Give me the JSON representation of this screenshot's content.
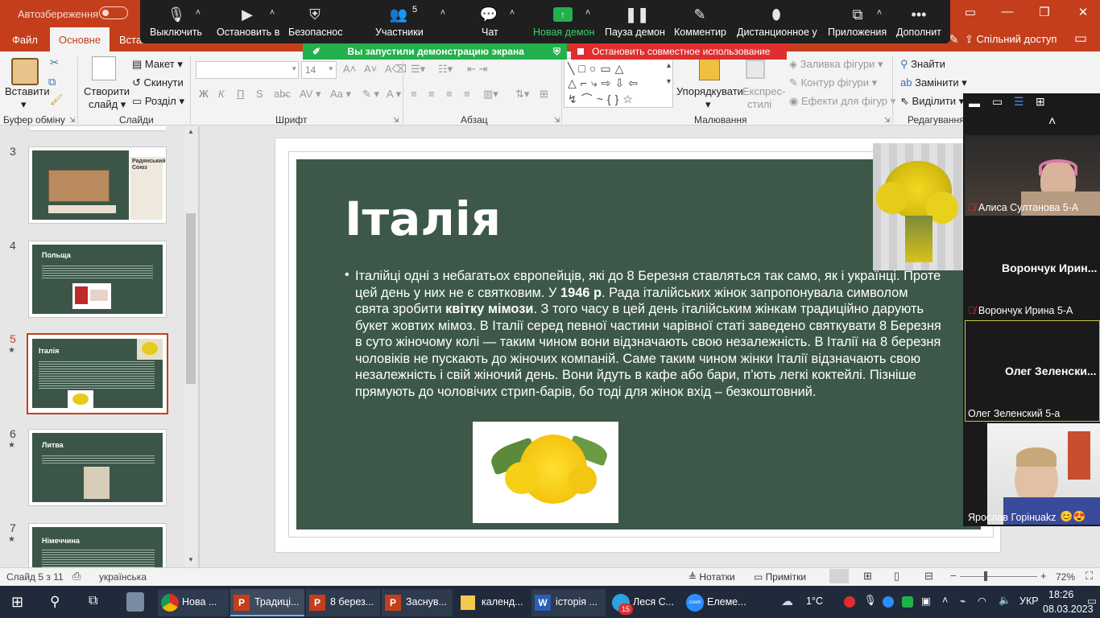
{
  "titlebar": {
    "autosave_label": "Автозбереження",
    "minimize": "—",
    "restore": "❐",
    "close": "✕"
  },
  "ribbon_tabs": {
    "file": "Файл",
    "home": "Основне",
    "insert": "Вставл",
    "share": "Спільний доступ"
  },
  "zoom_toolbar": {
    "mute": "Выключить",
    "stop_video": "Остановить в",
    "security": "Безопаснос",
    "participants": "Участники",
    "participants_count": "5",
    "chat": "Чат",
    "new_share": "Новая демон",
    "pause_share": "Пауза демон",
    "annotate": "Комментир",
    "remote_control": "Дистанционное у",
    "apps": "Приложения",
    "more": "Дополнит",
    "sharing_banner": "Вы запустили демонстрацию экрана",
    "stop_share": "Остановить совместное использование"
  },
  "ribbon": {
    "paste": "Вставити",
    "clipboard_group": "Буфер обміну",
    "new_slide": "Створити",
    "new_slide_2": "слайд",
    "layout": "Макет",
    "reset": "Скинути",
    "section": "Розділ",
    "slides_group": "Слайди",
    "font_size": "14",
    "font_group": "Шрифт",
    "bold": "Ж",
    "italic": "К",
    "underline": "П",
    "strike": "S",
    "paragraph_group": "Абзац",
    "arrange": "Упорядкувати",
    "quick_styles": "Експрес-",
    "quick_styles_2": "стилі",
    "shape_fill": "Заливка фігури",
    "shape_outline": "Контур фігури",
    "shape_effects": "Ефекти для фігур",
    "drawing_group": "Малювання",
    "find": "Знайти",
    "replace": "Замінити",
    "select": "Виділити",
    "editing_group": "Редагування"
  },
  "thumbnails": [
    {
      "num": "3",
      "title": "",
      "side_title": "Радянський Союз",
      "star": false
    },
    {
      "num": "4",
      "title": "Польща",
      "star": false
    },
    {
      "num": "5",
      "title": "Італія",
      "star": true
    },
    {
      "num": "6",
      "title": "Литва",
      "star": true
    },
    {
      "num": "7",
      "title": "Німеччина",
      "star": true
    }
  ],
  "slide": {
    "title": "Італія",
    "body_1": "Італійці одні з небагатьох європейців, які до 8 Березня ставляться так само, як і українці. Проте цей день у них не є святковим. У ",
    "body_bold_1": "1946 р",
    "body_2": ". Рада італійських жінок запропонувала символом свята зробити ",
    "body_bold_2": "квітку мімози",
    "body_3": ". З того часу в цей день італійським жінкам традиційно дарують букет жовтих мімоз. В Італії серед певної частини чарівної статі заведено святкувати 8 Березня в суто жіночому колі — таким чином вони відзначають свою незалежність. В Італії на 8 березня чоловіків не пускають до жіночих компаній. Саме таким чином жінки Італії відзначають свою незалежність і свій жіночий день. Вони йдуть в кафе або бари, п’ють легкі коктейлі. Пізніше прямують до чоловічих стрип-барів, бо тоді для жінок вхід – безкоштовний."
  },
  "gallery": {
    "p1_name": "Алиса Султанова 5-А",
    "p2_big": "Ворончук  Ирин...",
    "p2_name": "Ворончук Ирина 5-А",
    "p3_big": "Олег  Зеленски...",
    "p3_name": "Олег Зеленский 5-а",
    "p4_name": "Ярослав Горінuakz"
  },
  "statusbar": {
    "slide_info": "Слайд 5 з 11",
    "language": "українська",
    "notes": "Нотатки",
    "comments": "Примітки",
    "zoom": "72%"
  },
  "taskbar": {
    "app1": "Нова ...",
    "app2": "Традиці...",
    "app3": "8 берез...",
    "app4": "Заснув...",
    "app5": "календ...",
    "app6": "історія ...",
    "app7": "Леся С...",
    "app8": "Елеме...",
    "badge": "15",
    "weather": "1°C",
    "lang": "УКР",
    "time": "18:26",
    "date": "08.03.2023"
  }
}
